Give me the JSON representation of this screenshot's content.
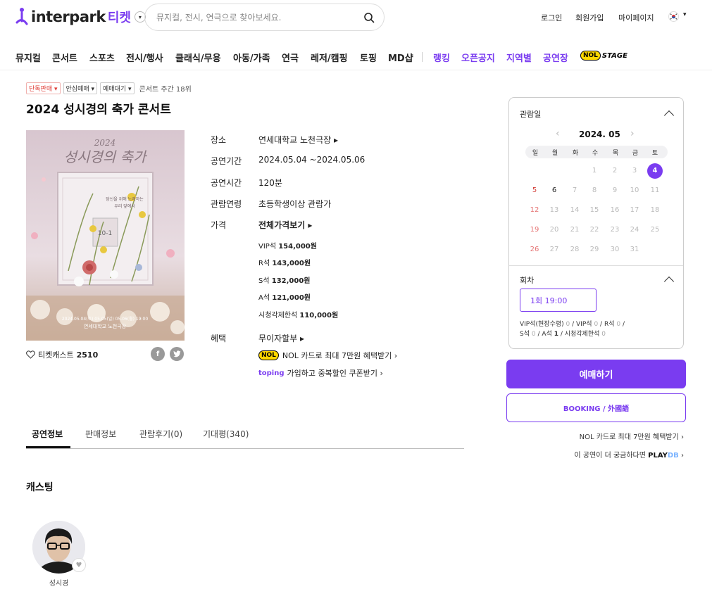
{
  "header": {
    "logo_text": "interpark",
    "logo_ticket": "티켓",
    "search_placeholder": "뮤지컬, 전시, 연극으로 찾아보세요.",
    "login": "로그인",
    "signup": "회원가입",
    "mypage": "마이페이지"
  },
  "nav": {
    "items": [
      "뮤지컬",
      "콘서트",
      "스포츠",
      "전시/행사",
      "클래식/무용",
      "아동/가족",
      "연극",
      "레저/캠핑",
      "토핑",
      "MD샵"
    ],
    "special": [
      "랭킹",
      "오픈공지",
      "지역별",
      "공연장"
    ],
    "nol": "NOL",
    "stage": "STAGE"
  },
  "tags": [
    "단독판매",
    "안심예매",
    "예매대기"
  ],
  "rank": "콘서트 주간 18위",
  "title": "2024 성시경의 축가 콘서트",
  "poster": {
    "year": "2024",
    "script_title": "성시경의 축가",
    "tagline_1": "당신을 위해 노래하는",
    "tagline_2": "우리 앞에서",
    "box_label": "10-1",
    "dates": "2024.05.04(토) 05.05(일) 05.06(월) 19:00",
    "venue": "연세대학교 노천극장"
  },
  "like": {
    "label": "티켓캐스트",
    "count": "2510"
  },
  "info": {
    "venue_label": "장소",
    "venue": "연세대학교 노천극장",
    "period_label": "공연기간",
    "period": "2024.05.04 ~2024.05.06",
    "runtime_label": "공연시간",
    "runtime": "120분",
    "age_label": "관람연령",
    "age": "초등학생이상 관람가",
    "price_label": "가격",
    "price_all": "전체가격보기",
    "prices": [
      {
        "seat": "VIP석",
        "price": "154,000원"
      },
      {
        "seat": "R석",
        "price": "143,000원"
      },
      {
        "seat": "S석",
        "price": "132,000원"
      },
      {
        "seat": "A석",
        "price": "121,000원"
      },
      {
        "seat": "시청각제한석",
        "price": "110,000원"
      }
    ],
    "benefit_label": "혜택",
    "benefit_1": "무이자할부",
    "benefit_2": "NOL 카드로 최대 7만원 혜택받기",
    "benefit_3_brand": "toping",
    "benefit_3": "가입하고 중복할인 쿠폰받기"
  },
  "tabs": [
    "공연정보",
    "판매정보",
    "관람후기(0)",
    "기대평(340)"
  ],
  "casting": {
    "title": "캐스팅",
    "members": [
      {
        "name": "성시경"
      }
    ]
  },
  "calendar": {
    "label": "관람일",
    "month": "2024. 05",
    "dow": [
      "일",
      "월",
      "화",
      "수",
      "목",
      "금",
      "토"
    ],
    "selected": 4,
    "available": [
      4,
      5,
      6
    ],
    "first_weekday": 3,
    "days_in_month": 31
  },
  "session": {
    "label": "회차",
    "slot": "1회 19:00",
    "seats": [
      {
        "name": "VIP석(현장수령)",
        "count": "0"
      },
      {
        "name": "VIP석",
        "count": "0"
      },
      {
        "name": "R석",
        "count": "0"
      },
      {
        "name": "S석",
        "count": "0"
      },
      {
        "name": "A석",
        "count": "1"
      },
      {
        "name": "시청각제한석",
        "count": "0"
      }
    ]
  },
  "buttons": {
    "reserve": "예매하기",
    "booking": "BOOKING / 外國語"
  },
  "side_links": {
    "nol_card": "NOL 카드로 최대 7만원 혜택받기",
    "playdb_text": "이 공연이 더 궁금하다면",
    "playdb_play": "PLAY",
    "playdb_db": "DB"
  },
  "colors": {
    "accent": "#7a3cf0",
    "sunday": "#d23a35"
  }
}
